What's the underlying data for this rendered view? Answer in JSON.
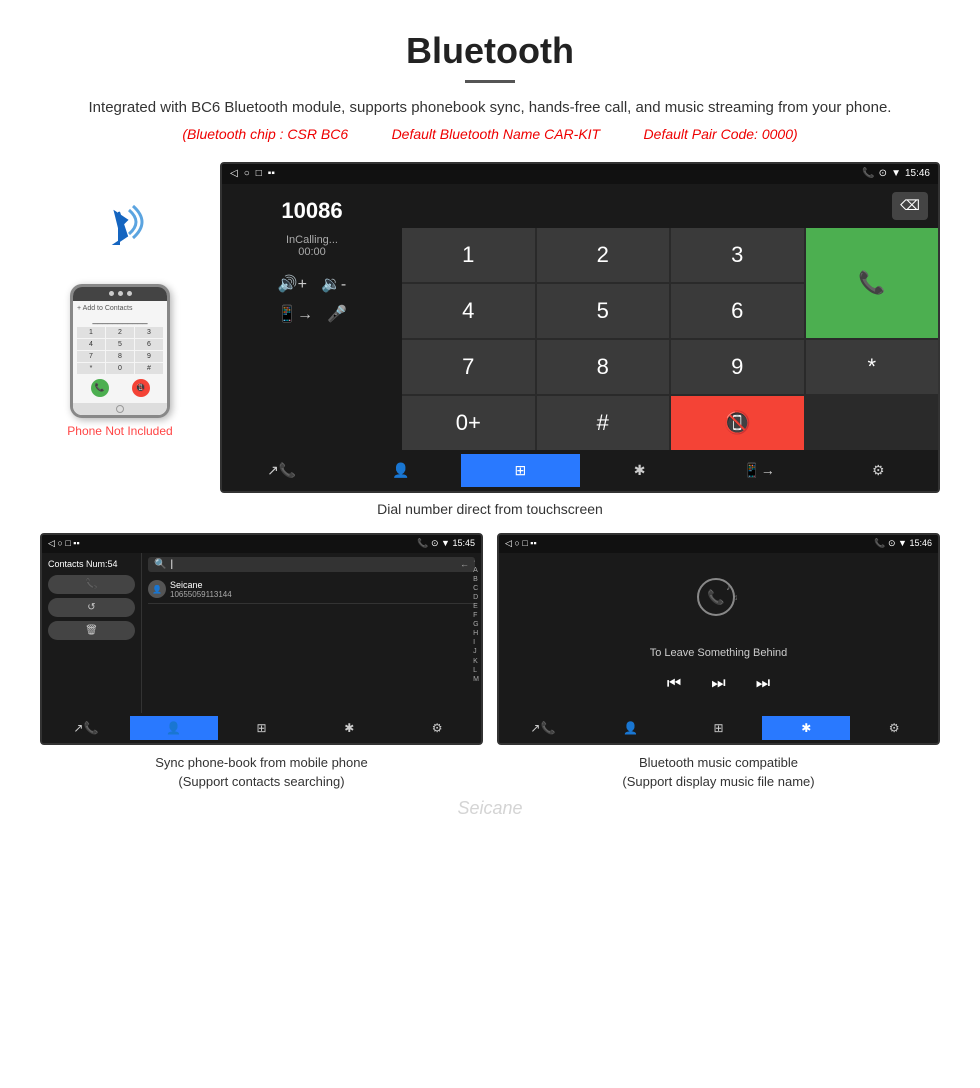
{
  "header": {
    "title": "Bluetooth",
    "description": "Integrated with BC6 Bluetooth module, supports phonebook sync, hands-free call, and music streaming from your phone.",
    "chips": {
      "chip": "(Bluetooth chip : CSR BC6",
      "name": "Default Bluetooth Name CAR-KIT",
      "code": "Default Pair Code: 0000)"
    }
  },
  "large_screen": {
    "statusbar": {
      "left": [
        "◁",
        "□",
        "⬜"
      ],
      "right": [
        "📞",
        "⊙",
        "▼",
        "15:46"
      ]
    },
    "dial": {
      "number": "10086",
      "status": "InCalling...",
      "time": "00:00"
    },
    "numpad": [
      "1",
      "2",
      "3",
      "*",
      "4",
      "5",
      "6",
      "0+",
      "7",
      "8",
      "9",
      "#"
    ],
    "bottom_icons": [
      "↗📞",
      "👤",
      "⊞",
      "✱",
      "📱→",
      "⚙"
    ]
  },
  "caption_large": "Dial number direct from touchscreen",
  "phone_left": {
    "not_included": "Phone Not Included"
  },
  "phonebook_screen": {
    "statusbar_right": "15:45",
    "contacts_num": "Contacts Num:54",
    "contact_name": "Seicane",
    "contact_number": "10655059113144",
    "index_letters": [
      "·",
      "A",
      "B",
      "C",
      "D",
      "E",
      "F",
      "G",
      "H",
      "I",
      "J",
      "K",
      "L",
      "M"
    ],
    "actions": [
      "📞",
      "↺",
      "🗑"
    ]
  },
  "music_screen": {
    "statusbar_right": "15:46",
    "song_title": "To Leave Something Behind"
  },
  "caption_phonebook_line1": "Sync phone-book from mobile phone",
  "caption_phonebook_line2": "(Support contacts searching)",
  "caption_music_line1": "Bluetooth music compatible",
  "caption_music_line2": "(Support display music file name)",
  "watermark": "Seicane"
}
